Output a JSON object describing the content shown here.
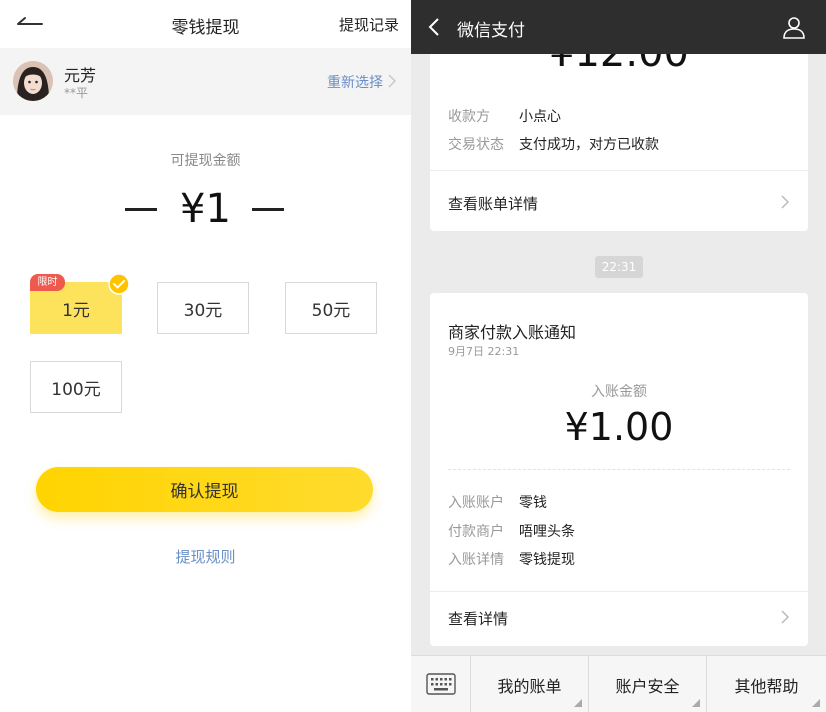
{
  "left": {
    "header": {
      "title": "零钱提现",
      "record_label": "提现记录"
    },
    "user": {
      "name": "元芳",
      "masked_name": "**平",
      "reselect_label": "重新选择"
    },
    "available_label": "可提现金额",
    "amount_display": "¥1",
    "options": [
      {
        "label": "1元",
        "selected": true,
        "badge": "限时"
      },
      {
        "label": "30元",
        "selected": false
      },
      {
        "label": "50元",
        "selected": false
      },
      {
        "label": "100元",
        "selected": false
      }
    ],
    "confirm_label": "确认提现",
    "rules_label": "提现规则",
    "colors": {
      "accent": "#ffd400",
      "link": "#6a8fc6",
      "badge": "#f05a4e"
    }
  },
  "right": {
    "header": {
      "title": "微信支付"
    },
    "payment_card": {
      "amount_partial": "12.00",
      "rows": [
        {
          "label": "收款方",
          "value": "小点心"
        },
        {
          "label": "交易状态",
          "value": "支付成功，对方已收款"
        }
      ],
      "link_label": "查看账单详情"
    },
    "time_divider": "22:31",
    "notice_card": {
      "title": "商家付款入账通知",
      "time": "9月7日  22:31",
      "amount_label": "入账金额",
      "amount": "¥1.00",
      "rows": [
        {
          "label": "入账账户",
          "value": "零钱"
        },
        {
          "label": "付款商户",
          "value": "唔哩头条"
        },
        {
          "label": "入账详情",
          "value": "零钱提现"
        }
      ],
      "link_label": "查看详情"
    },
    "footer": {
      "tabs": [
        "我的账单",
        "账户安全",
        "其他帮助"
      ]
    },
    "colors": {
      "header_bg": "#2e2e2e",
      "page_bg": "#ebebeb"
    }
  }
}
